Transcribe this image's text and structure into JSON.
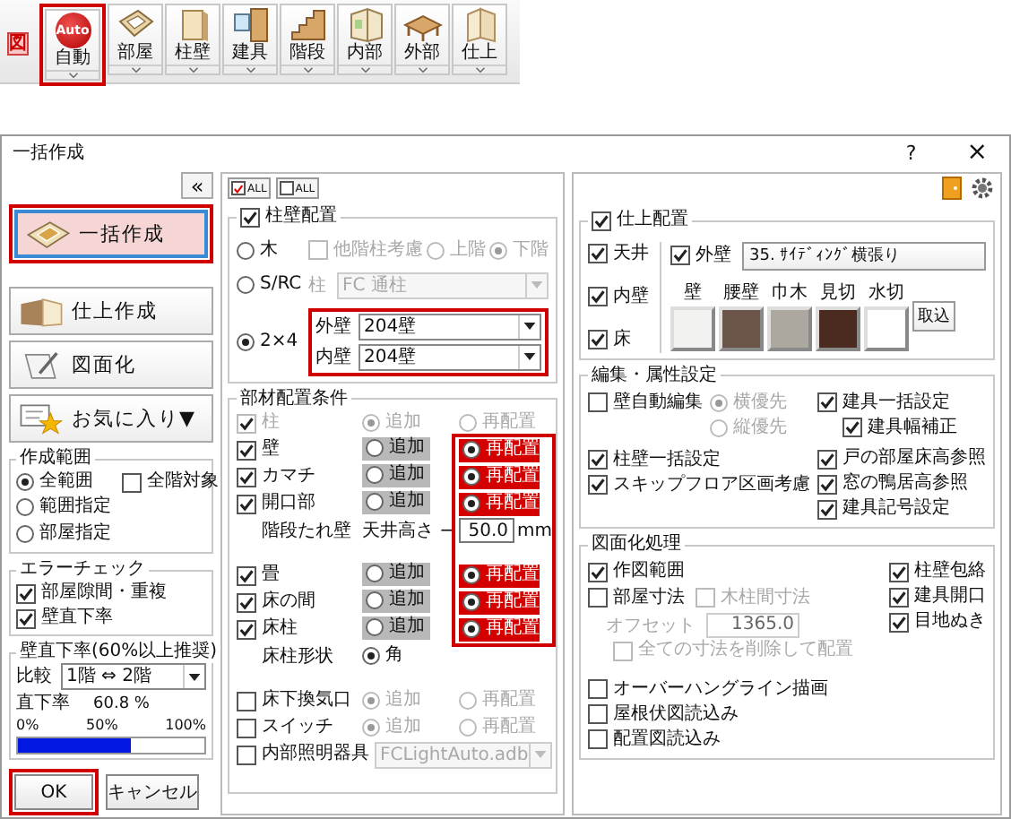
{
  "toolbar": {
    "badge": "図",
    "items": [
      {
        "label": "自動",
        "kind": "auto",
        "icon_text": "Auto",
        "highlighted": true
      },
      {
        "label": "部屋",
        "kind": "room",
        "highlighted": false
      },
      {
        "label": "柱壁",
        "kind": "wall",
        "highlighted": false
      },
      {
        "label": "建具",
        "kind": "door",
        "highlighted": false
      },
      {
        "label": "階段",
        "kind": "stairs",
        "highlighted": false
      },
      {
        "label": "内部",
        "kind": "interior",
        "highlighted": false
      },
      {
        "label": "外部",
        "kind": "exterior",
        "highlighted": false
      },
      {
        "label": "仕上",
        "kind": "finish",
        "highlighted": false
      }
    ]
  },
  "dialog": {
    "title": "一括作成",
    "help": "?",
    "close": "×",
    "left": {
      "collapse": "«",
      "modes": [
        {
          "label": "一括作成",
          "kind": "batch",
          "selected": true,
          "highlighted": true
        },
        {
          "label": "仕上作成",
          "kind": "finish",
          "selected": false,
          "highlighted": false
        },
        {
          "label": "図面化",
          "kind": "drawing",
          "selected": false,
          "highlighted": false
        },
        {
          "label": "お気に入り▼",
          "kind": "favorite",
          "selected": false,
          "highlighted": false
        }
      ],
      "range": {
        "title": "作成範囲",
        "options": [
          {
            "label": "全範囲",
            "selected": true
          },
          {
            "label": "範囲指定",
            "selected": false
          },
          {
            "label": "部屋指定",
            "selected": false
          }
        ],
        "all_floors": {
          "label": "全階対象",
          "checked": false
        }
      },
      "errors": {
        "title": "エラーチェック",
        "items": [
          {
            "label": "部屋隙間・重複",
            "checked": true
          },
          {
            "label": "壁直下率",
            "checked": true
          }
        ]
      },
      "ratio": {
        "title": "壁直下率(60%以上推奨)",
        "compare_label": "比較",
        "compare_value": "1階 ⇔ 2階",
        "rate_label": "直下率",
        "rate_value": "60.8 %",
        "ticks": [
          "0%",
          "50%",
          "100%"
        ],
        "level": 0.608
      },
      "buttons": [
        {
          "label": "OK",
          "highlighted": true
        },
        {
          "label": "キャンセル",
          "highlighted": false
        }
      ]
    },
    "middle": {
      "all_buttons": [
        {
          "label": "ALL",
          "checked": true
        },
        {
          "label": "ALL",
          "checked": false
        }
      ],
      "pillar_wall": {
        "title": "柱壁配置",
        "checked": true,
        "structures": [
          {
            "label": "木",
            "selected": false
          },
          {
            "label": "S/RC",
            "selected": false
          },
          {
            "label": "2×4",
            "selected": true
          }
        ],
        "other_floor": {
          "label": "他階柱考慮",
          "checked": false
        },
        "floor_options": [
          {
            "label": "上階",
            "selected": false
          },
          {
            "label": "下階",
            "selected": true
          }
        ],
        "pillar_label": "柱",
        "pillar_value": "FC 通柱",
        "walls_highlighted": true,
        "walls": [
          {
            "label": "外壁",
            "value": "204壁"
          },
          {
            "label": "内壁",
            "value": "204壁"
          }
        ]
      },
      "members": {
        "title": "部材配置条件",
        "blocks": [
          [
            {
              "kind": "choice",
              "label": "柱",
              "checked": true,
              "disabled": true,
              "highlighted": false,
              "options": [
                {
                  "label": "追加",
                  "selected": true
                },
                {
                  "label": "再配置",
                  "selected": false
                }
              ]
            },
            {
              "kind": "choice",
              "label": "壁",
              "checked": true,
              "disabled": false,
              "highlighted": true,
              "options": [
                {
                  "label": "追加",
                  "selected": false
                },
                {
                  "label": "再配置",
                  "selected": true
                }
              ]
            },
            {
              "kind": "choice",
              "label": "カマチ",
              "checked": true,
              "disabled": false,
              "highlighted": true,
              "options": [
                {
                  "label": "追加",
                  "selected": false
                },
                {
                  "label": "再配置",
                  "selected": true
                }
              ]
            },
            {
              "kind": "choice",
              "label": "開口部",
              "checked": true,
              "disabled": false,
              "highlighted": true,
              "options": [
                {
                  "label": "追加",
                  "selected": false
                },
                {
                  "label": "再配置",
                  "selected": true
                }
              ]
            },
            {
              "kind": "height",
              "label": "階段たれ壁",
              "prefix": "天井高さ −",
              "value": "50.0",
              "unit": "mm"
            }
          ],
          [
            {
              "kind": "choice",
              "label": "畳",
              "checked": true,
              "disabled": false,
              "highlighted": true,
              "options": [
                {
                  "label": "追加",
                  "selected": false
                },
                {
                  "label": "再配置",
                  "selected": true
                }
              ]
            },
            {
              "kind": "choice",
              "label": "床の間",
              "checked": true,
              "disabled": false,
              "highlighted": true,
              "options": [
                {
                  "label": "追加",
                  "selected": false
                },
                {
                  "label": "再配置",
                  "selected": true
                }
              ]
            },
            {
              "kind": "choice",
              "label": "床柱",
              "checked": true,
              "disabled": false,
              "highlighted": true,
              "options": [
                {
                  "label": "追加",
                  "selected": false
                },
                {
                  "label": "再配置",
                  "selected": true
                }
              ]
            },
            {
              "kind": "shape",
              "label": "床柱形状",
              "options": [
                {
                  "label": "角",
                  "selected": true
                }
              ]
            }
          ],
          [
            {
              "kind": "choice",
              "label": "床下換気口",
              "checked": false,
              "disabled": false,
              "highlighted": false,
              "options": [
                {
                  "label": "追加",
                  "selected": true
                },
                {
                  "label": "再配置",
                  "selected": false
                }
              ]
            },
            {
              "kind": "choice",
              "label": "スイッチ",
              "checked": false,
              "disabled": false,
              "highlighted": false,
              "options": [
                {
                  "label": "追加",
                  "selected": true
                },
                {
                  "label": "再配置",
                  "selected": false
                }
              ]
            },
            {
              "kind": "file",
              "label": "内部照明器具",
              "checked": false,
              "value": "FCLightAuto.adb"
            }
          ]
        ]
      }
    },
    "right": {
      "finish": {
        "title": "仕上配置",
        "checked": true,
        "parts": [
          {
            "label": "天井",
            "checked": true
          },
          {
            "label": "内壁",
            "checked": true
          },
          {
            "label": "床",
            "checked": true
          }
        ],
        "exterior": {
          "label": "外壁",
          "checked": true,
          "value": "35. ｻｲﾃﾞｨﾝｸﾞ横張り"
        },
        "swatches": [
          {
            "label": "壁",
            "color": "#f2f2f0"
          },
          {
            "label": "腰壁",
            "color": "#6b5448"
          },
          {
            "label": "巾木",
            "color": "#aca89f"
          },
          {
            "label": "見切",
            "color": "#4b2a1f"
          },
          {
            "label": "水切",
            "color": "#ffffff"
          }
        ],
        "import": "取込"
      },
      "edit": {
        "title": "編集・属性設定",
        "auto_edit": {
          "label": "壁自動編集",
          "checked": false
        },
        "priority": [
          {
            "label": "横優先",
            "selected": true
          },
          {
            "label": "縦優先",
            "selected": false
          }
        ],
        "left": [
          {
            "label": "柱壁一括設定",
            "checked": true
          },
          {
            "label": "スキップフロア区画考慮",
            "checked": true
          }
        ],
        "right": [
          {
            "label": "建具一括設定",
            "checked": true,
            "children": [
              {
                "label": "建具幅補正",
                "checked": true
              }
            ]
          },
          {
            "label": "戸の部屋床高参照",
            "checked": true
          },
          {
            "label": "窓の鴨居高参照",
            "checked": true
          },
          {
            "label": "建具記号設定",
            "checked": true
          }
        ]
      },
      "drawing": {
        "title": "図面化処理",
        "range": {
          "label": "作図範囲",
          "checked": true
        },
        "room_dim": {
          "label": "部屋寸法",
          "checked": false
        },
        "pillar_dim": {
          "label": "木柱間寸法",
          "checked": false
        },
        "offset": {
          "label": "オフセット",
          "value": "1365.0"
        },
        "delete_all": {
          "label": "全ての寸法を削除して配置",
          "checked": false
        },
        "right": [
          {
            "label": "柱壁包絡",
            "checked": true
          },
          {
            "label": "建具開口",
            "checked": true
          },
          {
            "label": "目地ぬき",
            "checked": true
          }
        ],
        "bottom": [
          {
            "label": "オーバーハングライン描画",
            "checked": false
          },
          {
            "label": "屋根伏図読込み",
            "checked": false
          },
          {
            "label": "配置図読込み",
            "checked": false
          }
        ]
      }
    }
  }
}
